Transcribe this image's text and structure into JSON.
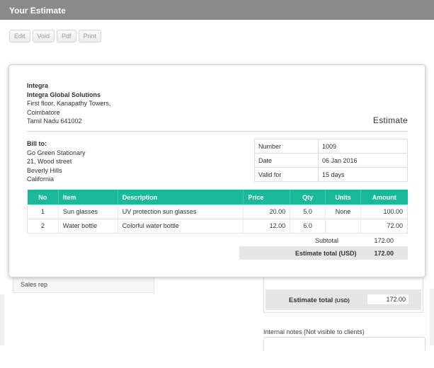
{
  "window": {
    "title": "Your Estimate"
  },
  "toolbar": {
    "edit": "Edit",
    "void": "Void",
    "pdf": "Pdf",
    "print": "Print"
  },
  "company": {
    "name": "Integra",
    "legal_name": "Integra Global Solutions",
    "address_line1": "First floor, Kanapathy Towers,",
    "address_line2": "Coimbatore",
    "address_line3": "Tamil Nadu 641002"
  },
  "document": {
    "title": "Estimate"
  },
  "bill_to": {
    "heading": "Bill to:",
    "name": "Go Green Stationary",
    "line1": "21, Wood street",
    "line2": "Beverly Hills",
    "line3": "California"
  },
  "meta": {
    "number_label": "Number",
    "number": "1009",
    "date_label": "Date",
    "date": "06 Jan 2016",
    "valid_label": "Valid for",
    "valid": "15 days"
  },
  "items": {
    "headers": {
      "no": "No",
      "item": "Item",
      "description": "Description",
      "price": "Price",
      "qty": "Qty",
      "units": "Units",
      "amount": "Amount"
    },
    "rows": [
      {
        "no": "1",
        "item": "Sun glasses",
        "description": "UV protection sun glasses",
        "price": "20.00",
        "qty": "5.0",
        "units": "None",
        "amount": "100.00"
      },
      {
        "no": "2",
        "item": "Water bottle",
        "description": "Colorful water bottle",
        "price": "12.00",
        "qty": "6.0",
        "units": "",
        "amount": "72.00"
      }
    ]
  },
  "totals": {
    "subtotal_label": "Subtotal",
    "subtotal": "172.00",
    "total_label": "Estimate total (USD)",
    "total": "172.00"
  },
  "background_form": {
    "sales_rep_label": "Sales rep",
    "total_label": "Estimate total",
    "total_currency": "(USD)",
    "total_value": "172.00",
    "notes_label": "Internal notes (Not visible to clients)"
  },
  "colors": {
    "titlebar": "#8a8a8a",
    "table_header": "#19b99a"
  }
}
